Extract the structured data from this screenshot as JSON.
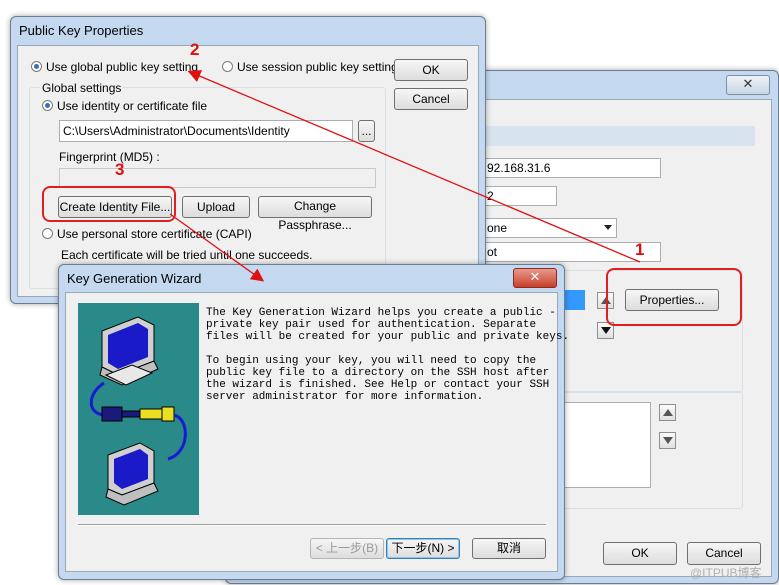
{
  "background_window": {
    "fields": {
      "host_value": "92.168.31.6",
      "port_value": "2",
      "dropdown_value": "one",
      "user_value": "ot"
    },
    "properties_button": "Properties...",
    "ok_button": "OK",
    "cancel_button": "Cancel",
    "close_glyph": "✕"
  },
  "pubkey_dialog": {
    "title": "Public Key Properties",
    "radio_global": "Use global public key setting",
    "radio_session": "Use session public key setting",
    "ok_button": "OK",
    "cancel_button": "Cancel",
    "global_settings_label": "Global settings",
    "radio_identity": "Use identity or certificate file",
    "identity_path": "C:\\Users\\Administrator\\Documents\\Identity",
    "browse_button": "...",
    "fingerprint_label": "Fingerprint (MD5) :",
    "fingerprint_value": "",
    "create_identity_button": "Create Identity File...",
    "upload_button": "Upload",
    "change_passphrase_button": "Change Passphrase...",
    "radio_capi": "Use personal store certificate (CAPI)",
    "capi_note": "Each certificate will be tried until one succeeds."
  },
  "wizard": {
    "title": "Key Generation Wizard",
    "close_glyph": "✕",
    "paragraph1": "The Key Generation Wizard helps you create a public -\nprivate key pair used for authentication. Separate\nfiles will be created for your public and private keys.",
    "paragraph2": "To begin using your key, you will need to copy the\npublic key file to a directory on the SSH host after\nthe wizard is finished. See Help or contact your SSH\nserver administrator for more information.",
    "back_button": "< 上一步(B)",
    "next_button": "下一步(N) >",
    "cancel_button": "取消"
  },
  "annotations": {
    "step1": "1",
    "step2": "2",
    "step3": "3",
    "color": "#e01010"
  },
  "watermark": "@ITPUB博客"
}
